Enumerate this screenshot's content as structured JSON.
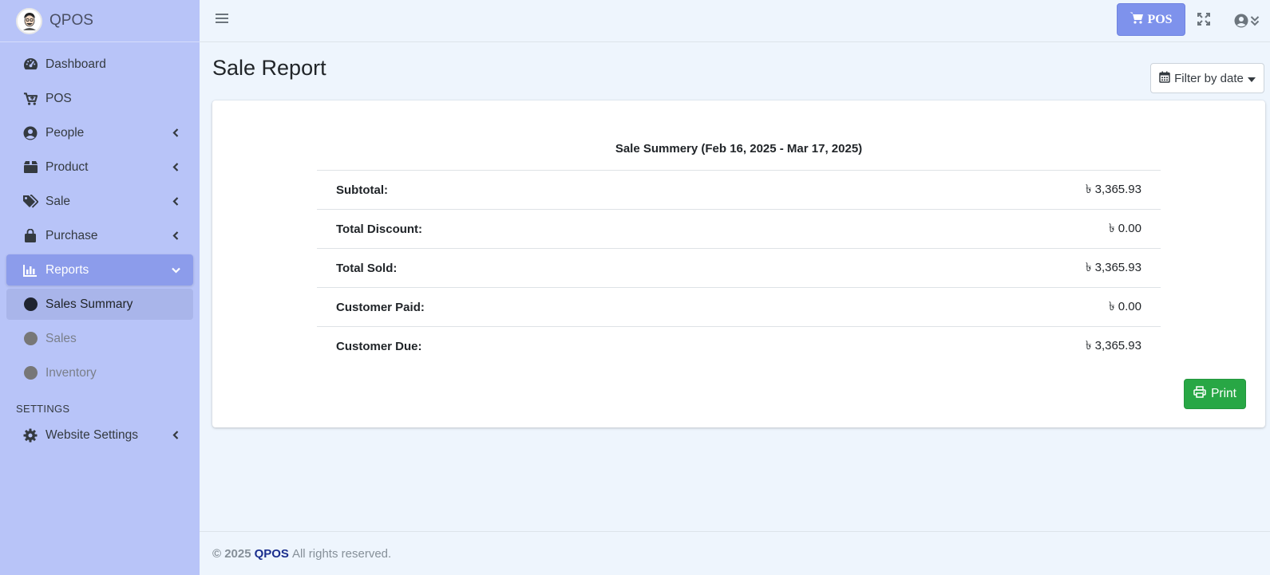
{
  "brand": {
    "name": "QPOS"
  },
  "sidebar": {
    "items": [
      {
        "label": "Dashboard",
        "icon": "tachometer-icon"
      },
      {
        "label": "POS",
        "icon": "cart-plus-icon"
      },
      {
        "label": "People",
        "icon": "user-circle-icon"
      },
      {
        "label": "Product",
        "icon": "box-icon"
      },
      {
        "label": "Sale",
        "icon": "tags-icon"
      },
      {
        "label": "Purchase",
        "icon": "shopping-bag-icon"
      },
      {
        "label": "Reports",
        "icon": "bar-chart-icon"
      }
    ],
    "reports_sub": [
      {
        "label": "Sales Summary"
      },
      {
        "label": "Sales"
      },
      {
        "label": "Inventory"
      }
    ],
    "settings_header": "SETTINGS",
    "settings_items": [
      {
        "label": "Website Settings",
        "icon": "gear-icon"
      }
    ]
  },
  "topbar": {
    "pos_label": "POS"
  },
  "page": {
    "title": "Sale Report",
    "filter_label": "Filter by date"
  },
  "summary": {
    "title": "Sale Summery (Feb 16, 2025 - Mar 17, 2025)",
    "rows": [
      {
        "label": "Subtotal:",
        "value": "৳ 3,365.93"
      },
      {
        "label": "Total Discount:",
        "value": "৳ 0.00"
      },
      {
        "label": "Total Sold:",
        "value": "৳ 3,365.93"
      },
      {
        "label": "Customer Paid:",
        "value": "৳ 0.00"
      },
      {
        "label": "Customer Due:",
        "value": "৳ 3,365.93"
      }
    ],
    "print_label": "Print"
  },
  "footer": {
    "copyright": "© 2025",
    "brand": "QPOS",
    "rights": "All rights reserved."
  },
  "colors": {
    "sidebar_bg": "#b8c4f8",
    "active_item": "#8c9ceb",
    "pos_button": "#7e92ec",
    "print_button": "#28a745",
    "page_bg": "#eef5fd"
  }
}
